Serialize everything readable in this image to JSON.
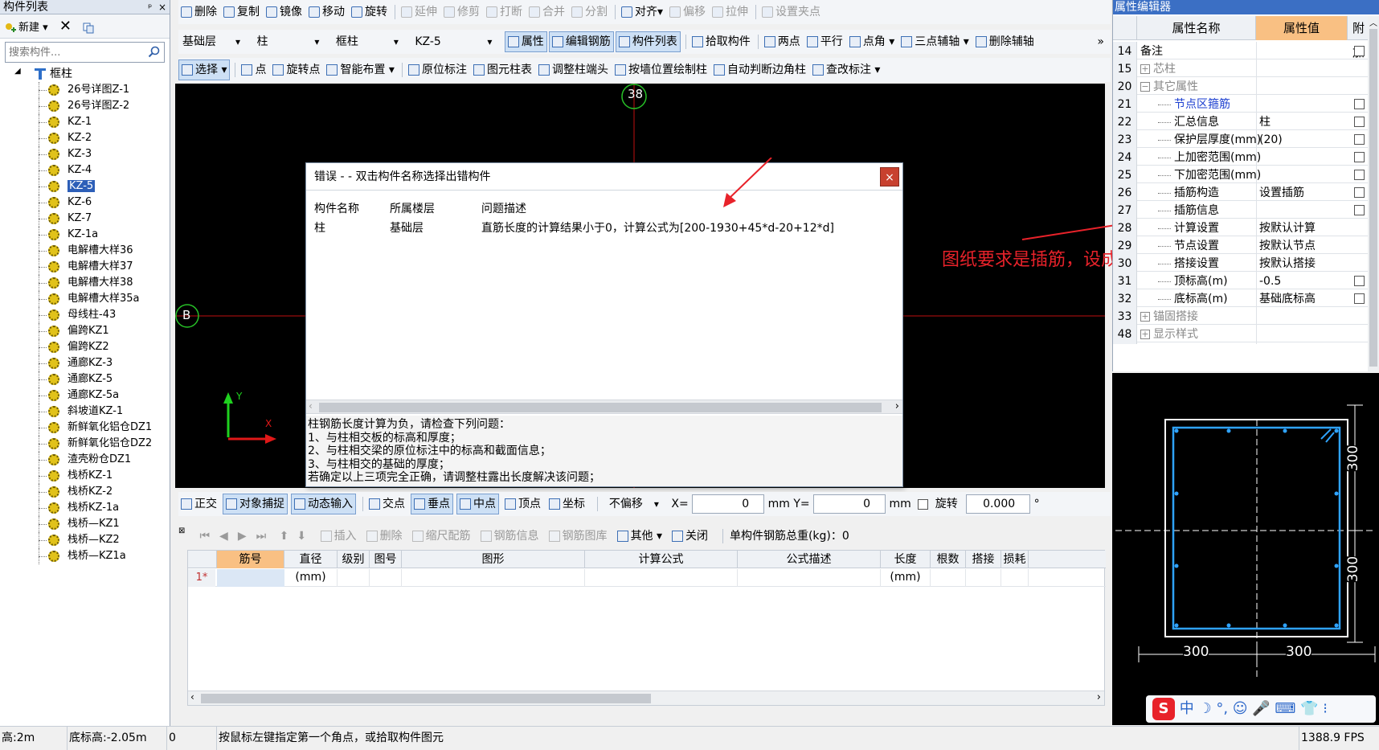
{
  "left_panel": {
    "title": "构件列表",
    "pin": "ᵖ",
    "close": "×",
    "new_label": "新建",
    "search_placeholder": "搜索构件...",
    "tree_root": "框柱",
    "items": [
      "26号详图Z-1",
      "26号详图Z-2",
      "KZ-1",
      "KZ-2",
      "KZ-3",
      "KZ-4",
      "KZ-5",
      "KZ-6",
      "KZ-7",
      "KZ-1a",
      "电解槽大样36",
      "电解槽大样37",
      "电解槽大样38",
      "电解槽大样35a",
      "母线柱-43",
      "偏跨KZ1",
      "偏跨KZ2",
      "通廊KZ-3",
      "通廊KZ-5",
      "通廊KZ-5a",
      "斜坡道KZ-1",
      "新鲜氧化铝仓DZ1",
      "新鲜氧化铝仓DZ2",
      "渣壳粉仓DZ1",
      "栈桥KZ-1",
      "栈桥KZ-2",
      "栈桥KZ-1a",
      "栈桥—KZ1",
      "栈桥—KZ2",
      "栈桥—KZ1a"
    ],
    "selected_index": 6
  },
  "toolbar1": [
    "删除",
    "复制",
    "镜像",
    "移动",
    "旋转",
    "延伸",
    "修剪",
    "打断",
    "合并",
    "分割",
    "对齐",
    "偏移",
    "拉伸",
    "设置夹点"
  ],
  "toolbar2": {
    "floor": "基础层",
    "type": "柱",
    "subtype": "框柱",
    "component": "KZ-5",
    "buttons": [
      "属性",
      "编辑钢筋",
      "构件列表",
      "拾取构件",
      "两点",
      "平行",
      "点角",
      "三点辅轴",
      "删除辅轴"
    ],
    "more": "»"
  },
  "toolbar3": [
    "选择",
    "点",
    "旋转点",
    "智能布置",
    "原位标注",
    "图元柱表",
    "调整柱端头",
    "按墙位置绘制柱",
    "自动判断边角柱",
    "查改标注"
  ],
  "canvas": {
    "axis_top": "38",
    "axis_left": "B",
    "y_label": "Y",
    "x_label": "X"
  },
  "error_dialog": {
    "title": "错误 - - 双击构件名称选择出错构件",
    "close": "×",
    "columns": [
      "构件名称",
      "所属楼层",
      "问题描述"
    ],
    "rows": [
      {
        "name": "柱",
        "floor": "基础层",
        "desc": "直筋长度的计算结果小于0，计算公式为[200-1930+45*d-20+12*d]"
      }
    ],
    "hint": [
      "柱钢筋长度计算为负，请检查下列问题：",
      "1、与柱相交板的标高和厚度；",
      "2、与柱相交梁的原位标注中的标高和截面信息；",
      "3、与柱相交的基础的厚度；",
      "若确定以上三项完全正确，请调整柱露出长度解决该问题；"
    ]
  },
  "snapbar": {
    "items": [
      "正交",
      "对象捕捉",
      "动态输入",
      "交点",
      "垂点",
      "中点",
      "顶点",
      "坐标"
    ],
    "offset": "不偏移",
    "x_label": "X=",
    "x_value": "0",
    "unit": "mm",
    "y_label": "Y=",
    "y_value": "0",
    "rotate_label": "旋转",
    "rotate_value": "0.000",
    "deg": "°"
  },
  "rebar_toolbar": {
    "items": [
      "插入",
      "删除",
      "缩尺配筋",
      "钢筋信息",
      "钢筋图库",
      "其他",
      "关闭"
    ],
    "total_label": "单构件钢筋总重(kg)：0"
  },
  "grid": {
    "headers": [
      "筋号",
      "直径(mm)",
      "级别",
      "图号",
      "图形",
      "计算公式",
      "公式描述",
      "长度(mm)",
      "根数",
      "搭接",
      "损耗"
    ],
    "row_marker": "1*"
  },
  "statusbar": {
    "height": "高:2m",
    "bottom": "底标高:-2.05m",
    "zero": "0",
    "hint": "按鼠标左键指定第一个角点，或拾取构件图元",
    "fps": "1388.9 FPS"
  },
  "property_editor": {
    "title": "属性编辑器",
    "headers": [
      "属性名称",
      "属性值",
      "附加"
    ],
    "rows": [
      {
        "n": "14",
        "name": "备注",
        "value": "",
        "chk": true,
        "indent": 0,
        "exp": ""
      },
      {
        "n": "15",
        "name": "芯柱",
        "value": "",
        "chk": false,
        "indent": 0,
        "exp": "+",
        "muted": true
      },
      {
        "n": "20",
        "name": "其它属性",
        "value": "",
        "chk": false,
        "indent": 0,
        "exp": "−",
        "muted": true
      },
      {
        "n": "21",
        "name": "节点区箍筋",
        "value": "",
        "chk": true,
        "indent": 1,
        "exp": "",
        "blue": true
      },
      {
        "n": "22",
        "name": "汇总信息",
        "value": "柱",
        "chk": true,
        "indent": 1,
        "exp": ""
      },
      {
        "n": "23",
        "name": "保护层厚度(mm)",
        "value": "(20)",
        "chk": true,
        "indent": 1,
        "exp": ""
      },
      {
        "n": "24",
        "name": "上加密范围(mm)",
        "value": "",
        "chk": true,
        "indent": 1,
        "exp": ""
      },
      {
        "n": "25",
        "name": "下加密范围(mm)",
        "value": "",
        "chk": true,
        "indent": 1,
        "exp": ""
      },
      {
        "n": "26",
        "name": "插筋构造",
        "value": "设置插筋",
        "chk": true,
        "indent": 1,
        "exp": ""
      },
      {
        "n": "27",
        "name": "插筋信息",
        "value": "",
        "chk": true,
        "indent": 1,
        "exp": ""
      },
      {
        "n": "28",
        "name": "计算设置",
        "value": "按默认计算",
        "chk": false,
        "indent": 1,
        "exp": ""
      },
      {
        "n": "29",
        "name": "节点设置",
        "value": "按默认节点",
        "chk": false,
        "indent": 1,
        "exp": ""
      },
      {
        "n": "30",
        "name": "搭接设置",
        "value": "按默认搭接",
        "chk": false,
        "indent": 1,
        "exp": ""
      },
      {
        "n": "31",
        "name": "顶标高(m)",
        "value": "-0.5",
        "chk": true,
        "indent": 1,
        "exp": ""
      },
      {
        "n": "32",
        "name": "底标高(m)",
        "value": "基础底标高",
        "chk": true,
        "indent": 1,
        "exp": ""
      },
      {
        "n": "33",
        "name": "锚固搭接",
        "value": "",
        "chk": false,
        "indent": 0,
        "exp": "+",
        "muted": true
      },
      {
        "n": "48",
        "name": "显示样式",
        "value": "",
        "chk": false,
        "indent": 0,
        "exp": "+",
        "muted": true
      }
    ]
  },
  "preview": {
    "dim_w1": "300",
    "dim_w2": "300",
    "dim_h1": "300",
    "dim_h2": "300"
  },
  "ime": {
    "chars": "中 ☽ °, ☺ 🎤 ⌨ 👕 ⁝"
  },
  "annotation": "图纸要求是插筋，设成纵筋错误不正确",
  "colors": {
    "selection": "#2d5fb8",
    "annotation": "#e8222a",
    "prop_title": "#3b6fc4",
    "canvas": "#000000",
    "axis_line": "#c01010",
    "axis_circle": "#27c227"
  }
}
